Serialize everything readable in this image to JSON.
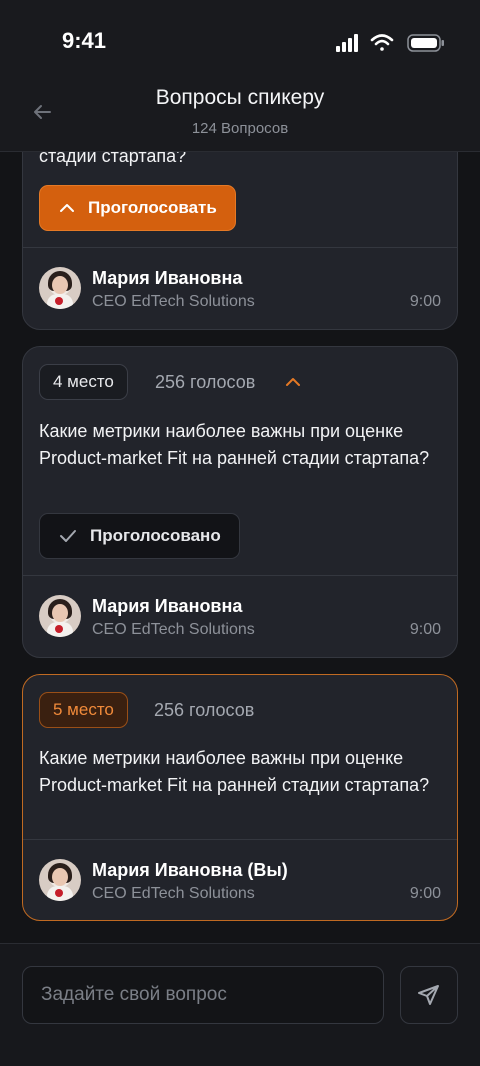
{
  "status_bar": {
    "time": "9:41"
  },
  "header": {
    "title": "Вопросы спикеру",
    "subtitle": "124 Вопросов"
  },
  "cards": [
    {
      "question_tail": "стадии стартапа?",
      "vote_label": "Проголосовать",
      "author": {
        "name": "Мария Ивановна",
        "role": "CEO EdTech Solutions",
        "time": "9:00"
      }
    },
    {
      "rank": "4 место",
      "votes": "256 голосов",
      "question": "Какие метрики наиболее важны при оценке Product-market Fit на ранней стадии стартапа?",
      "voted_label": "Проголосовано",
      "author": {
        "name": "Мария Ивановна",
        "role": "CEO EdTech Solutions",
        "time": "9:00"
      }
    },
    {
      "rank": "5 место",
      "votes": "256 голосов",
      "question": "Какие метрики наиболее важны при оценке Product-market Fit на ранней стадии стартапа?",
      "author": {
        "name": "Мария Ивановна (Вы)",
        "role": "CEO EdTech Solutions",
        "time": "9:00"
      }
    }
  ],
  "composer": {
    "placeholder": "Задайте свой вопрос"
  },
  "colors": {
    "accent": "#d4600e",
    "accent_border": "#c06a22",
    "background": "#131417",
    "card": "#22242b"
  },
  "icons": {
    "back": "arrow-left-icon",
    "upvote": "chevron-up-icon",
    "voted": "check-icon",
    "send": "send-icon"
  }
}
